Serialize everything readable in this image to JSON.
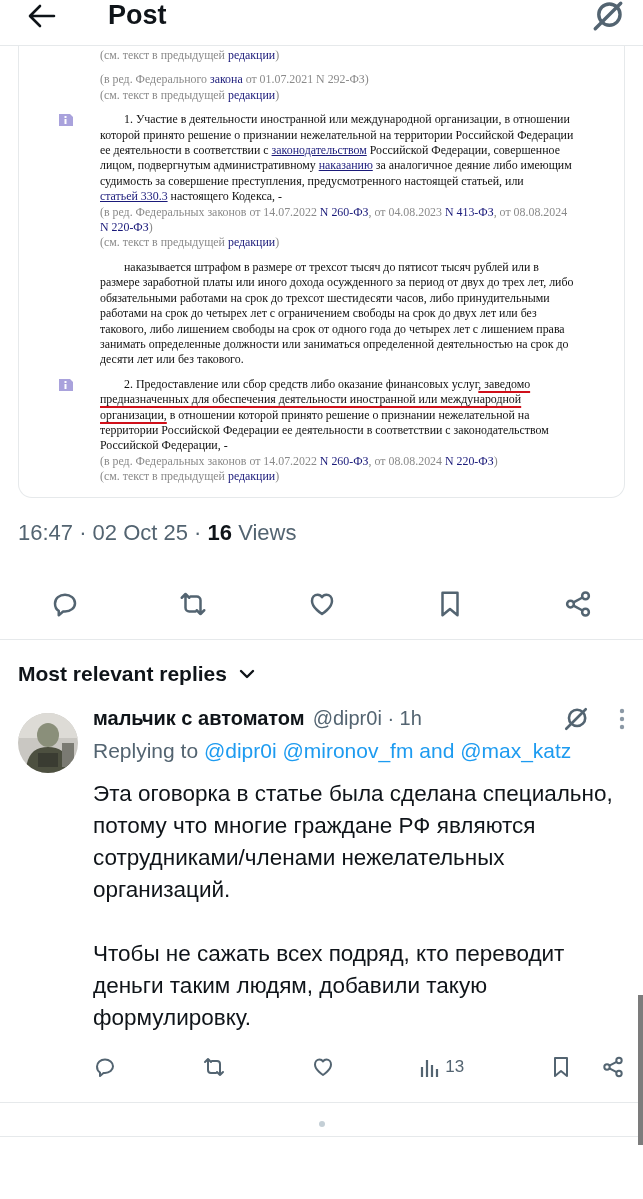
{
  "header": {
    "title": "Post"
  },
  "document": {
    "blocks": [
      {
        "kind": "note",
        "lines": [
          [
            {
              "text": "(см. текст в предыдущей ",
              "kind": "plain"
            },
            {
              "text": "редакции",
              "kind": "link"
            },
            {
              "text": ")",
              "kind": "plain"
            }
          ]
        ]
      },
      {
        "kind": "note",
        "lines": [
          [
            {
              "text": "(в ред. Федерального ",
              "kind": "plain"
            },
            {
              "text": "закона",
              "kind": "link"
            },
            {
              "text": " от 01.07.2021 N 292-ФЗ)",
              "kind": "plain"
            }
          ],
          [
            {
              "text": "(см. текст в предыдущей ",
              "kind": "plain"
            },
            {
              "text": "редакции",
              "kind": "link"
            },
            {
              "text": ")",
              "kind": "plain"
            }
          ]
        ]
      },
      {
        "kind": "para",
        "marker": true,
        "parts": [
          {
            "text": "1. Участие в деятельности иностранной или международной организации, в отношении которой принято решение о признании нежелательной на территории Российской Федерации ее деятельности в соответствии с ",
            "kind": "plain"
          },
          {
            "text": "законодательством",
            "kind": "link"
          },
          {
            "text": " Российской Федерации, совершенное лицом, подвергнутым административному ",
            "kind": "plain"
          },
          {
            "text": "наказанию",
            "kind": "link"
          },
          {
            "text": " за аналогичное деяние либо имеющим судимость за совершение преступления, предусмотренного настоящей статьей, или ",
            "kind": "plain"
          },
          {
            "text": "статьей 330.3",
            "kind": "link"
          },
          {
            "text": " настоящего Кодекса, -",
            "kind": "plain"
          }
        ]
      },
      {
        "kind": "note",
        "lines": [
          [
            {
              "text": "(в ред. Федеральных законов от 14.07.2022 ",
              "kind": "plain"
            },
            {
              "text": "N 260-ФЗ",
              "kind": "ref"
            },
            {
              "text": ", от 04.08.2023 ",
              "kind": "plain"
            },
            {
              "text": "N 413-ФЗ",
              "kind": "ref"
            },
            {
              "text": ", от 08.08.2024 ",
              "kind": "plain"
            },
            {
              "text": "N 220-ФЗ",
              "kind": "ref"
            },
            {
              "text": ")",
              "kind": "plain"
            }
          ],
          [
            {
              "text": "(см. текст в предыдущей ",
              "kind": "plain"
            },
            {
              "text": "редакции",
              "kind": "link"
            },
            {
              "text": ")",
              "kind": "plain"
            }
          ]
        ]
      },
      {
        "kind": "para",
        "marker": false,
        "parts": [
          {
            "text": "наказывается штрафом в размере от трехсот тысяч до пятисот тысяч рублей или в размере заработной платы или иного дохода осужденного за период от двух до трех лет, либо обязательными работами на срок до трехсот шестидесяти часов, либо принудительными работами на срок до четырех лет с ограничением свободы на срок до двух лет или без такового, либо лишением свободы на срок от одного года до четырех лет с лишением права занимать определенные должности или заниматься определенной деятельностью на срок до десяти лет или без такового.",
            "kind": "plain"
          }
        ]
      },
      {
        "kind": "para",
        "marker": true,
        "parts": [
          {
            "text": "2. Предоставление или сбор средств либо оказание финансовых услуг",
            "kind": "plain"
          },
          {
            "text": ", заведомо предназначенных для обеспечения деятельности иностранной или международной организации,",
            "kind": "marked"
          },
          {
            "text": " в отношении которой принято решение о признании нежелательной на территории Российской Федерации ее деятельности в соответствии с законодательством Российской Федерации, -",
            "kind": "plain"
          }
        ]
      },
      {
        "kind": "note",
        "lines": [
          [
            {
              "text": "(в ред. Федеральных законов от 14.07.2022 ",
              "kind": "plain"
            },
            {
              "text": "N 260-ФЗ",
              "kind": "ref"
            },
            {
              "text": ", от 08.08.2024 ",
              "kind": "plain"
            },
            {
              "text": "N 220-ФЗ",
              "kind": "ref"
            },
            {
              "text": ")",
              "kind": "plain"
            }
          ],
          [
            {
              "text": "(см. текст в предыдущей ",
              "kind": "plain"
            },
            {
              "text": "редакции",
              "kind": "link"
            },
            {
              "text": ")",
              "kind": "plain"
            }
          ]
        ]
      }
    ]
  },
  "post_meta": "16:47 · 02 Oct 25 · **16** Views",
  "replies_header": {
    "label": "Most relevant replies"
  },
  "reply": {
    "name": "мальчик с автоматом",
    "handle_time": "@dipr0i · 1h",
    "replying": [
      {
        "text": "Replying to",
        "kind": "plain"
      },
      {
        "text": "@dipr0i",
        "kind": "mention"
      },
      {
        "text": "@mironov_fm",
        "kind": "mention"
      },
      {
        "text": "and",
        "kind": "accent"
      },
      {
        "text": "@max_katz",
        "kind": "mention"
      }
    ],
    "paragraphs": [
      "Эта оговорка в статье была сделана специально, потому что многие граждане РФ являются сотрудниками/членами нежелательных организаций.",
      "Чтобы не сажать всех подряд, кто переводит деньги таким людям, добавили такую формулировку."
    ],
    "views": "13"
  }
}
